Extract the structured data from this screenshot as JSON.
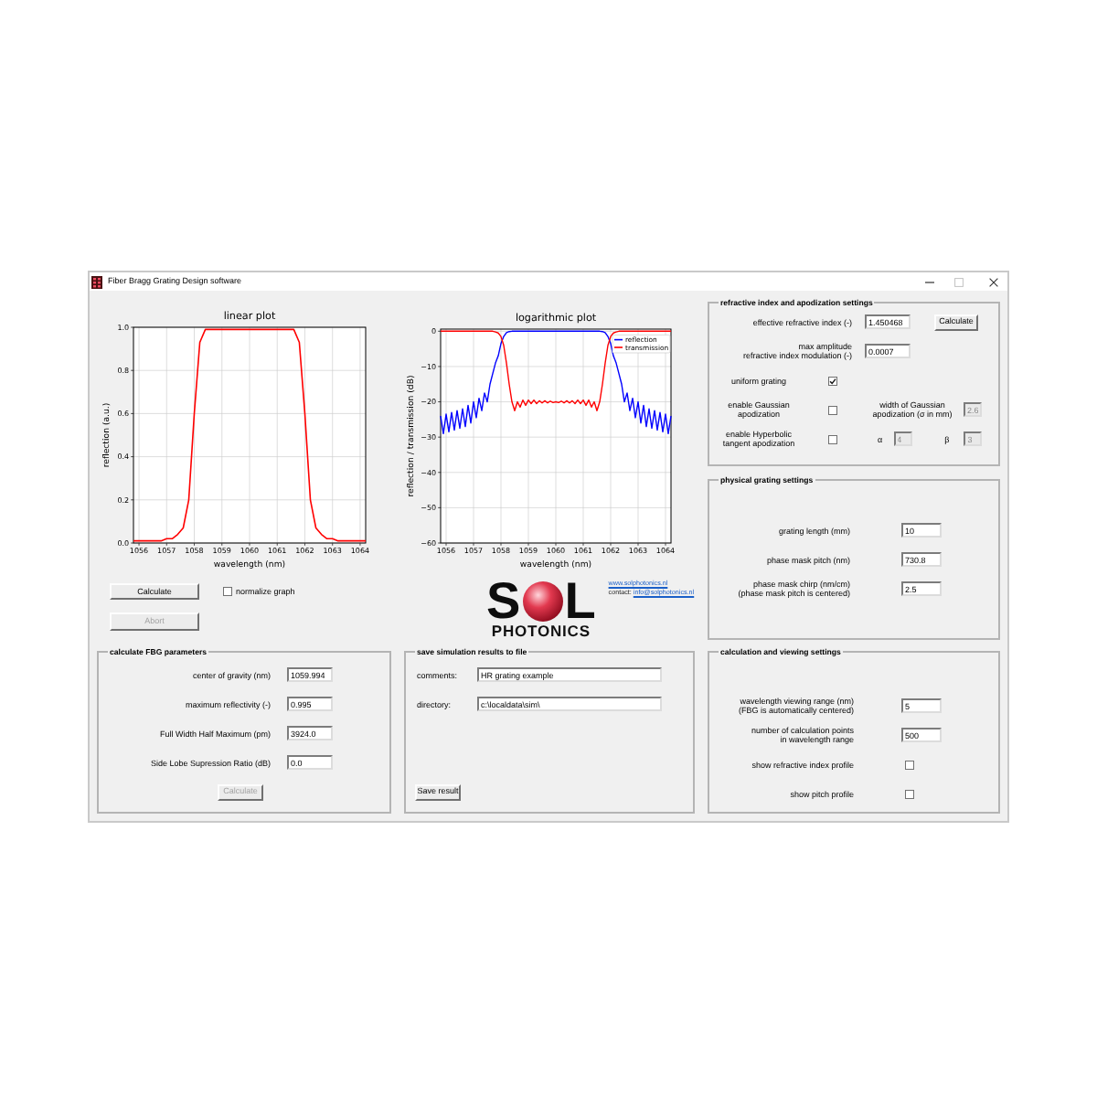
{
  "window": {
    "title": "Fiber Bragg Grating Design software",
    "controls": [
      {
        "kind": "minimize",
        "disabled": false
      },
      {
        "kind": "maximize",
        "disabled": true
      },
      {
        "kind": "close",
        "disabled": false
      }
    ]
  },
  "linear_plot": {
    "chart_data": {
      "type": "line",
      "title": "linear plot",
      "xlabel": "wavelength (nm)",
      "ylabel": "reflection (a.u.)",
      "x": [
        1055.8,
        1056,
        1056.2,
        1056.4,
        1056.6,
        1056.8,
        1057,
        1057.2,
        1057.4,
        1057.6,
        1057.8,
        1058,
        1058.2,
        1058.4,
        1058.6,
        1058.8,
        1059,
        1059.2,
        1059.4,
        1059.6,
        1059.8,
        1060,
        1060.2,
        1060.4,
        1060.6,
        1060.8,
        1061,
        1061.2,
        1061.4,
        1061.6,
        1061.8,
        1062,
        1062.2,
        1062.4,
        1062.6,
        1062.8,
        1063,
        1063.2,
        1063.4,
        1063.6,
        1063.8,
        1064,
        1064.2
      ],
      "series": [
        {
          "color": "#ff0000",
          "values": [
            0.01,
            0.01,
            0.01,
            0.01,
            0.01,
            0.01,
            0.02,
            0.02,
            0.04,
            0.07,
            0.2,
            0.6,
            0.93,
            0.99,
            0.99,
            0.99,
            0.99,
            0.99,
            0.99,
            0.99,
            0.99,
            0.99,
            0.99,
            0.99,
            0.99,
            0.99,
            0.99,
            0.99,
            0.99,
            0.99,
            0.93,
            0.6,
            0.2,
            0.07,
            0.04,
            0.02,
            0.02,
            0.01,
            0.01,
            0.01,
            0.01,
            0.01,
            0.01
          ]
        }
      ],
      "xlim": [
        1055.8,
        1064.2
      ],
      "ylim": [
        0,
        1
      ],
      "xticks": [
        1056,
        1057,
        1058,
        1059,
        1060,
        1061,
        1062,
        1063,
        1064
      ],
      "yticks": [
        {
          "value": 0,
          "label": "0.0"
        },
        {
          "value": 0.2,
          "label": "0.2"
        },
        {
          "value": 0.4,
          "label": "0.4"
        },
        {
          "value": 0.6,
          "label": "0.6"
        },
        {
          "value": 0.8,
          "label": "0.8"
        },
        {
          "value": 1,
          "label": "1.0"
        }
      ],
      "grid": true
    }
  },
  "plot_controls": {
    "calculate_button": {
      "label": "Calculate",
      "disabled": false
    },
    "normalize_graph": {
      "label": "normalize graph",
      "checked": false
    },
    "abort_button": {
      "label": "Abort",
      "disabled": true
    }
  },
  "logarithmic_plot": {
    "chart_data": {
      "type": "line",
      "title": "logarithmic plot",
      "xlabel": "wavelength (nm)",
      "ylabel": "reflection / transmission (dB)",
      "x": [
        1055.8,
        1055.9,
        1056,
        1056.1,
        1056.2,
        1056.3,
        1056.4,
        1056.5,
        1056.6,
        1056.7,
        1056.8,
        1056.9,
        1057,
        1057.1,
        1057.2,
        1057.3,
        1057.4,
        1057.5,
        1057.6,
        1057.7,
        1057.8,
        1057.9,
        1058,
        1058.1,
        1058.2,
        1058.3,
        1058.4,
        1058.5,
        1058.6,
        1058.7,
        1058.8,
        1058.9,
        1059,
        1059.1,
        1059.2,
        1059.3,
        1059.4,
        1059.5,
        1059.6,
        1059.7,
        1059.8,
        1059.9,
        1060,
        1060.1,
        1060.2,
        1060.3,
        1060.4,
        1060.5,
        1060.6,
        1060.7,
        1060.8,
        1060.9,
        1061,
        1061.1,
        1061.2,
        1061.3,
        1061.4,
        1061.5,
        1061.6,
        1061.7,
        1061.8,
        1061.9,
        1062,
        1062.1,
        1062.2,
        1062.3,
        1062.4,
        1062.5,
        1062.6,
        1062.7,
        1062.8,
        1062.9,
        1063,
        1063.1,
        1063.2,
        1063.3,
        1063.4,
        1063.5,
        1063.6,
        1063.7,
        1063.8,
        1063.9,
        1064,
        1064.1,
        1064.2
      ],
      "series": [
        {
          "name": "reflection",
          "color": "#0000ff",
          "values": [
            -24,
            -29,
            -23.5,
            -28.5,
            -23,
            -28,
            -22.5,
            -27.5,
            -22,
            -27,
            -21,
            -26,
            -20,
            -24.5,
            -19,
            -22.5,
            -17.5,
            -20,
            -15,
            -12,
            -9,
            -7,
            -3.5,
            -1.5,
            -0.4,
            -0.1,
            0,
            0,
            0,
            0,
            0,
            0,
            0,
            0,
            0,
            0,
            0,
            0,
            0,
            0,
            0,
            0,
            0,
            0,
            0,
            0,
            0,
            0,
            0,
            0,
            0,
            0,
            0,
            0,
            0,
            0,
            0,
            0,
            0,
            -0.1,
            -0.4,
            -1.5,
            -3.5,
            -7,
            -9,
            -12,
            -15,
            -20,
            -17.5,
            -22.5,
            -19,
            -24.5,
            -20,
            -26,
            -21,
            -27,
            -22,
            -27.5,
            -22.5,
            -28,
            -23,
            -28.5,
            -23.5,
            -29,
            -24
          ]
        },
        {
          "name": "transmission",
          "color": "#ff0000",
          "values": [
            0,
            0,
            0,
            0,
            0,
            0,
            0,
            0,
            0,
            0,
            0,
            0,
            0,
            0,
            0,
            0,
            0,
            0,
            0,
            0,
            -0.2,
            -0.5,
            -1.5,
            -4,
            -9,
            -15,
            -20,
            -22.5,
            -20,
            -21.5,
            -19.5,
            -21,
            -19.5,
            -20.5,
            -19.5,
            -20.5,
            -19.7,
            -20.3,
            -19.7,
            -20.3,
            -19.8,
            -20.2,
            -20,
            -20.2,
            -19.8,
            -20.3,
            -19.7,
            -20.3,
            -19.7,
            -20.5,
            -19.5,
            -20.5,
            -19.5,
            -21,
            -19.5,
            -21.5,
            -20,
            -22.5,
            -20,
            -15,
            -9,
            -4,
            -1.5,
            -0.5,
            -0.2,
            0,
            0,
            0,
            0,
            0,
            0,
            0,
            0,
            0,
            0,
            0,
            0,
            0,
            0,
            0,
            0,
            0,
            0,
            0,
            0
          ]
        }
      ],
      "xlim": [
        1055.8,
        1064.2
      ],
      "ylim": [
        -60,
        0.6
      ],
      "xticks": [
        1056,
        1057,
        1058,
        1059,
        1060,
        1061,
        1062,
        1063,
        1064
      ],
      "yticks": [
        {
          "value": 0,
          "label": "0"
        },
        {
          "value": -10,
          "label": "−10"
        },
        {
          "value": -20,
          "label": "−20"
        },
        {
          "value": -30,
          "label": "−30"
        },
        {
          "value": -40,
          "label": "−40"
        },
        {
          "value": -50,
          "label": "−50"
        },
        {
          "value": -60,
          "label": "−60"
        }
      ],
      "grid": true,
      "legend": "upper right"
    }
  },
  "logo": {
    "letter_start": "S",
    "letter_end": "L",
    "tagline": "PHOTONICS"
  },
  "contact": {
    "website": "www.solphotonics.nl",
    "email_label": "contact:",
    "email": "info@solphotonics.nl"
  },
  "refractive_index_settings": {
    "title": "refractive index and apodization settings",
    "effective_index": {
      "label": "effective refractive index (-)",
      "value": "1.450468"
    },
    "calculate_button": {
      "label": "Calculate",
      "disabled": false
    },
    "modulation": {
      "label": "max amplitude\nrefractive index modulation (-)",
      "value": "0.0007"
    },
    "uniform_grating": {
      "label": "uniform grating",
      "checked": true
    },
    "gaussian_apodization": {
      "label": "enable Gaussian\napodization",
      "checked": false,
      "width_label": "width of Gaussian\napodization (σ in mm)",
      "width_value": "2.6",
      "width_disabled": true
    },
    "hyperbolic_apodization": {
      "label": "enable Hyperbolic\ntangent apodization",
      "checked": false,
      "alpha_label": "α",
      "alpha_value": "4",
      "beta_label": "β",
      "beta_value": "3",
      "params_disabled": true
    }
  },
  "physical_grating_settings": {
    "title": "physical grating settings",
    "fields": [
      {
        "label": "grating length (mm)",
        "value": "10"
      },
      {
        "label": "phase mask pitch (nm)",
        "value": "730.8"
      },
      {
        "label": "phase mask chirp (nm/cm)\n(phase mask pitch is centered)",
        "value": "2.5"
      }
    ]
  },
  "fbg_parameters": {
    "title": "calculate FBG parameters",
    "fields": [
      {
        "label": "center of gravity (nm)",
        "value": "1059.994"
      },
      {
        "label": "maximum reflectivity (-)",
        "value": "0.995"
      },
      {
        "label": "Full Width Half Maximum (pm)",
        "value": "3924.0"
      },
      {
        "label": "Side Lobe Supression Ratio (dB)",
        "value": "0.0"
      }
    ],
    "calculate_button": {
      "label": "Calculate",
      "disabled": true
    }
  },
  "save_results": {
    "title": "save simulation results to file",
    "fields": [
      {
        "label": "comments:",
        "value": "HR grating example"
      },
      {
        "label": "directory:",
        "value": "c:\\localdata\\sim\\"
      }
    ],
    "save_button": {
      "label": "Save result",
      "disabled": false
    }
  },
  "calculation_settings": {
    "title": "calculation and viewing settings",
    "fields": [
      {
        "kind": "input",
        "label": "wavelength viewing range (nm)\n(FBG is automatically centered)",
        "value": "5"
      },
      {
        "kind": "input",
        "label": "number of calculation points\nin wavelength range",
        "value": "500"
      },
      {
        "kind": "checkbox",
        "label": "show refractive index profile",
        "checked": false
      },
      {
        "kind": "checkbox",
        "label": "show pitch profile",
        "checked": false
      }
    ]
  }
}
